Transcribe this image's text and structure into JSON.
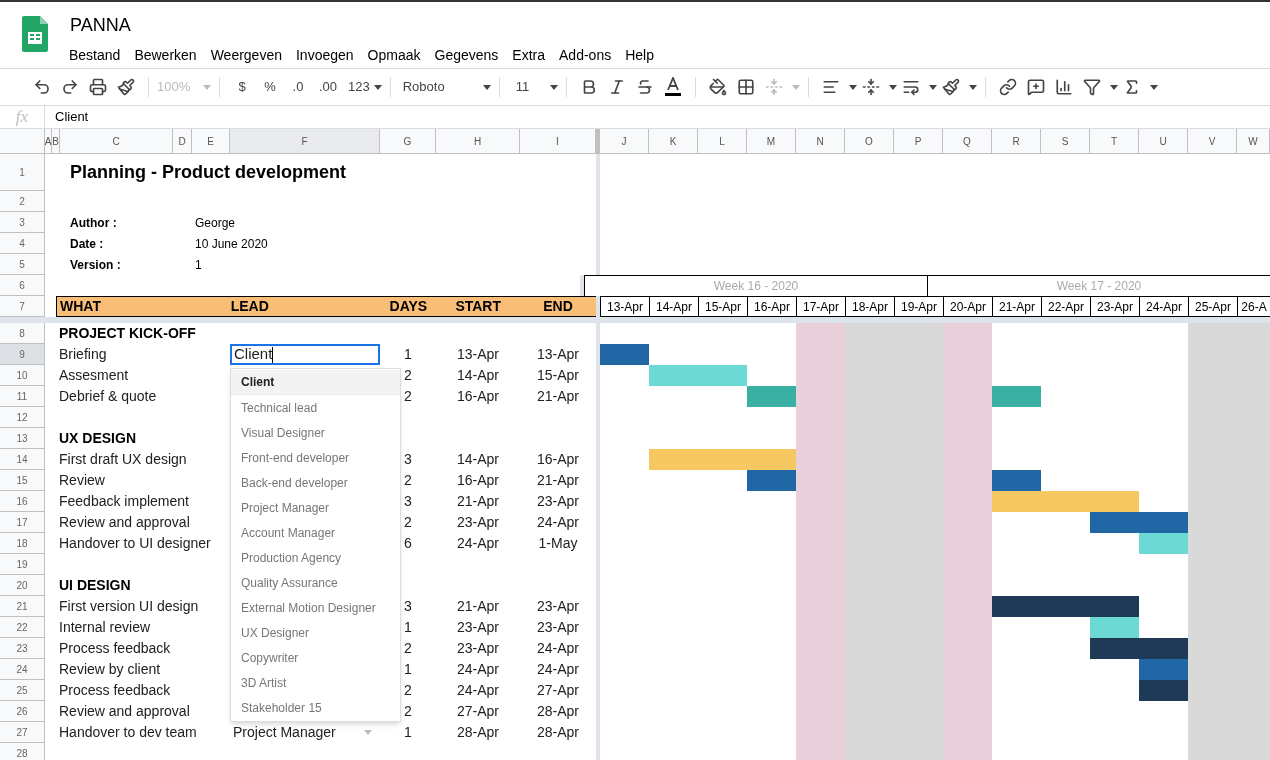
{
  "app": {
    "title": "PANNA",
    "menu": [
      "Bestand",
      "Bewerken",
      "Weergeven",
      "Invoegen",
      "Opmaak",
      "Gegevens",
      "Extra",
      "Add-ons",
      "Help"
    ]
  },
  "toolbar": {
    "zoom": "100%",
    "currency": "$",
    "percent": "%",
    "decrease_decimals": ".0",
    "increase_decimals": ".00",
    "number_format": "123",
    "font": "Roboto",
    "font_size": "11"
  },
  "formula_bar": {
    "label": "fx",
    "value": "Client"
  },
  "columns": [
    {
      "label": "A",
      "selected": false
    },
    {
      "label": "B",
      "selected": false
    },
    {
      "label": "C",
      "selected": false
    },
    {
      "label": "D",
      "selected": false
    },
    {
      "label": "E",
      "selected": false
    },
    {
      "label": "F",
      "selected": true
    },
    {
      "label": "G",
      "selected": false
    },
    {
      "label": "H",
      "selected": false
    },
    {
      "label": "I",
      "selected": false
    },
    {
      "label": "J",
      "selected": false
    },
    {
      "label": "K",
      "selected": false
    },
    {
      "label": "L",
      "selected": false
    },
    {
      "label": "M",
      "selected": false
    },
    {
      "label": "N",
      "selected": false
    },
    {
      "label": "O",
      "selected": false
    },
    {
      "label": "P",
      "selected": false
    },
    {
      "label": "Q",
      "selected": false
    },
    {
      "label": "R",
      "selected": false
    },
    {
      "label": "S",
      "selected": false
    },
    {
      "label": "T",
      "selected": false
    },
    {
      "label": "U",
      "selected": false
    },
    {
      "label": "V",
      "selected": false
    },
    {
      "label": "W",
      "selected": false
    }
  ],
  "row_numbers": [
    {
      "label": "1",
      "selected": false
    },
    {
      "label": "2",
      "selected": false
    },
    {
      "label": "3",
      "selected": false
    },
    {
      "label": "4",
      "selected": false
    },
    {
      "label": "5",
      "selected": false
    },
    {
      "label": "6",
      "selected": false
    },
    {
      "label": "7",
      "selected": false
    },
    {
      "label": "8",
      "selected": false
    },
    {
      "label": "9",
      "selected": true
    },
    {
      "label": "10",
      "selected": false
    },
    {
      "label": "11",
      "selected": false
    },
    {
      "label": "12",
      "selected": false
    },
    {
      "label": "13",
      "selected": false
    },
    {
      "label": "14",
      "selected": false
    },
    {
      "label": "15",
      "selected": false
    },
    {
      "label": "16",
      "selected": false
    },
    {
      "label": "17",
      "selected": false
    },
    {
      "label": "18",
      "selected": false
    },
    {
      "label": "19",
      "selected": false
    },
    {
      "label": "20",
      "selected": false
    },
    {
      "label": "21",
      "selected": false
    },
    {
      "label": "22",
      "selected": false
    },
    {
      "label": "23",
      "selected": false
    },
    {
      "label": "24",
      "selected": false
    },
    {
      "label": "25",
      "selected": false
    },
    {
      "label": "26",
      "selected": false
    },
    {
      "label": "27",
      "selected": false
    },
    {
      "label": "28",
      "selected": false
    }
  ],
  "sheet": {
    "title": "Planning - Product development",
    "meta": [
      {
        "label": "Author :",
        "value": "George"
      },
      {
        "label": "Date :",
        "value": "10 June 2020"
      },
      {
        "label": "Version :",
        "value": "1"
      }
    ],
    "headers": [
      "WHAT",
      "LEAD",
      "DAYS",
      "START",
      "END"
    ],
    "weeks": [
      "Week 16 - 2020",
      "Week 17 - 2020"
    ],
    "days": [
      {
        "label": "13-Apr",
        "kind": "workday"
      },
      {
        "label": "14-Apr",
        "kind": "workday"
      },
      {
        "label": "15-Apr",
        "kind": "workday"
      },
      {
        "label": "16-Apr",
        "kind": "workday"
      },
      {
        "label": "17-Apr",
        "kind": "holiday"
      },
      {
        "label": "18-Apr",
        "kind": "weekend"
      },
      {
        "label": "19-Apr",
        "kind": "weekend"
      },
      {
        "label": "20-Apr",
        "kind": "holiday"
      },
      {
        "label": "21-Apr",
        "kind": "workday"
      },
      {
        "label": "22-Apr",
        "kind": "workday"
      },
      {
        "label": "23-Apr",
        "kind": "workday"
      },
      {
        "label": "24-Apr",
        "kind": "workday"
      },
      {
        "label": "25-Apr",
        "kind": "weekend"
      },
      {
        "label": "26-A",
        "kind": "weekend"
      }
    ],
    "rows": [
      {
        "kind": "section",
        "what": "PROJECT KICK-OFF"
      },
      {
        "kind": "task",
        "what": "Briefing",
        "lead": "Client",
        "editing": true,
        "days": "1",
        "start": "13-Apr",
        "end": "13-Apr",
        "timeline": [
          {
            "kind": "bar",
            "color": "#2166a5"
          },
          {
            "kind": "empty"
          },
          {
            "kind": "empty"
          },
          {
            "kind": "empty"
          },
          {
            "kind": "empty"
          },
          {
            "kind": "empty"
          },
          {
            "kind": "empty"
          },
          {
            "kind": "empty"
          },
          {
            "kind": "empty"
          },
          {
            "kind": "empty"
          },
          {
            "kind": "empty"
          },
          {
            "kind": "empty"
          },
          {
            "kind": "empty"
          },
          {
            "kind": "empty"
          }
        ]
      },
      {
        "kind": "task",
        "what": "Assesment",
        "days": "2",
        "start": "14-Apr",
        "end": "15-Apr",
        "timeline": [
          {
            "kind": "empty"
          },
          {
            "kind": "bar",
            "color": "#6dd9d4"
          },
          {
            "kind": "bar",
            "color": "#6dd9d4"
          },
          {
            "kind": "empty"
          },
          {
            "kind": "empty"
          },
          {
            "kind": "empty"
          },
          {
            "kind": "empty"
          },
          {
            "kind": "empty"
          },
          {
            "kind": "empty"
          },
          {
            "kind": "empty"
          },
          {
            "kind": "empty"
          },
          {
            "kind": "empty"
          },
          {
            "kind": "empty"
          },
          {
            "kind": "empty"
          }
        ]
      },
      {
        "kind": "task",
        "what": "Debrief & quote",
        "days": "2",
        "start": "16-Apr",
        "end": "21-Apr",
        "timeline": [
          {
            "kind": "empty"
          },
          {
            "kind": "empty"
          },
          {
            "kind": "empty"
          },
          {
            "kind": "bar",
            "color": "#3aafa4"
          },
          {
            "kind": "empty"
          },
          {
            "kind": "empty"
          },
          {
            "kind": "empty"
          },
          {
            "kind": "empty"
          },
          {
            "kind": "bar",
            "color": "#3aafa4"
          },
          {
            "kind": "empty"
          },
          {
            "kind": "empty"
          },
          {
            "kind": "empty"
          },
          {
            "kind": "empty"
          },
          {
            "kind": "empty"
          }
        ]
      },
      {
        "kind": "blank"
      },
      {
        "kind": "section",
        "what": "UX DESIGN"
      },
      {
        "kind": "task",
        "what": "First draft UX design",
        "days": "3",
        "start": "14-Apr",
        "end": "16-Apr",
        "timeline": [
          {
            "kind": "empty"
          },
          {
            "kind": "bar",
            "color": "#f5c862"
          },
          {
            "kind": "bar",
            "color": "#f5c862"
          },
          {
            "kind": "bar",
            "color": "#f5c862"
          },
          {
            "kind": "empty"
          },
          {
            "kind": "empty"
          },
          {
            "kind": "empty"
          },
          {
            "kind": "empty"
          },
          {
            "kind": "empty"
          },
          {
            "kind": "empty"
          },
          {
            "kind": "empty"
          },
          {
            "kind": "empty"
          },
          {
            "kind": "empty"
          },
          {
            "kind": "empty"
          }
        ]
      },
      {
        "kind": "task",
        "what": "Review",
        "days": "2",
        "start": "16-Apr",
        "end": "21-Apr",
        "timeline": [
          {
            "kind": "empty"
          },
          {
            "kind": "empty"
          },
          {
            "kind": "empty"
          },
          {
            "kind": "bar",
            "color": "#2166a5"
          },
          {
            "kind": "empty"
          },
          {
            "kind": "empty"
          },
          {
            "kind": "empty"
          },
          {
            "kind": "empty"
          },
          {
            "kind": "bar",
            "color": "#2166a5"
          },
          {
            "kind": "empty"
          },
          {
            "kind": "empty"
          },
          {
            "kind": "empty"
          },
          {
            "kind": "empty"
          },
          {
            "kind": "empty"
          }
        ]
      },
      {
        "kind": "task",
        "what": "Feedback implement",
        "days": "3",
        "start": "21-Apr",
        "end": "23-Apr",
        "timeline": [
          {
            "kind": "empty"
          },
          {
            "kind": "empty"
          },
          {
            "kind": "empty"
          },
          {
            "kind": "empty"
          },
          {
            "kind": "empty"
          },
          {
            "kind": "empty"
          },
          {
            "kind": "empty"
          },
          {
            "kind": "empty"
          },
          {
            "kind": "bar",
            "color": "#f5c862"
          },
          {
            "kind": "bar",
            "color": "#f5c862"
          },
          {
            "kind": "bar",
            "color": "#f5c862"
          },
          {
            "kind": "empty"
          },
          {
            "kind": "empty"
          },
          {
            "kind": "empty"
          }
        ]
      },
      {
        "kind": "task",
        "what": "Review and approval",
        "days": "2",
        "start": "23-Apr",
        "end": "24-Apr",
        "timeline": [
          {
            "kind": "empty"
          },
          {
            "kind": "empty"
          },
          {
            "kind": "empty"
          },
          {
            "kind": "empty"
          },
          {
            "kind": "empty"
          },
          {
            "kind": "empty"
          },
          {
            "kind": "empty"
          },
          {
            "kind": "empty"
          },
          {
            "kind": "empty"
          },
          {
            "kind": "empty"
          },
          {
            "kind": "bar",
            "color": "#2166a5"
          },
          {
            "kind": "bar",
            "color": "#2166a5"
          },
          {
            "kind": "empty"
          },
          {
            "kind": "empty"
          }
        ]
      },
      {
        "kind": "task",
        "what": "Handover to UI designer",
        "days": "6",
        "start": "24-Apr",
        "end": "1-May",
        "timeline": [
          {
            "kind": "empty"
          },
          {
            "kind": "empty"
          },
          {
            "kind": "empty"
          },
          {
            "kind": "empty"
          },
          {
            "kind": "empty"
          },
          {
            "kind": "empty"
          },
          {
            "kind": "empty"
          },
          {
            "kind": "empty"
          },
          {
            "kind": "empty"
          },
          {
            "kind": "empty"
          },
          {
            "kind": "empty"
          },
          {
            "kind": "bar",
            "color": "#6dd9d4"
          },
          {
            "kind": "empty"
          },
          {
            "kind": "empty"
          }
        ]
      },
      {
        "kind": "blank"
      },
      {
        "kind": "section",
        "what": "UI DESIGN"
      },
      {
        "kind": "task",
        "what": "First version UI design",
        "days": "3",
        "start": "21-Apr",
        "end": "23-Apr",
        "timeline": [
          {
            "kind": "empty"
          },
          {
            "kind": "empty"
          },
          {
            "kind": "empty"
          },
          {
            "kind": "empty"
          },
          {
            "kind": "empty"
          },
          {
            "kind": "empty"
          },
          {
            "kind": "empty"
          },
          {
            "kind": "empty"
          },
          {
            "kind": "bar",
            "color": "#1e3a56"
          },
          {
            "kind": "bar",
            "color": "#1e3a56"
          },
          {
            "kind": "bar",
            "color": "#1e3a56"
          },
          {
            "kind": "empty"
          },
          {
            "kind": "empty"
          },
          {
            "kind": "empty"
          }
        ]
      },
      {
        "kind": "task",
        "what": "Internal review",
        "days": "1",
        "start": "23-Apr",
        "end": "23-Apr",
        "timeline": [
          {
            "kind": "empty"
          },
          {
            "kind": "empty"
          },
          {
            "kind": "empty"
          },
          {
            "kind": "empty"
          },
          {
            "kind": "empty"
          },
          {
            "kind": "empty"
          },
          {
            "kind": "empty"
          },
          {
            "kind": "empty"
          },
          {
            "kind": "empty"
          },
          {
            "kind": "empty"
          },
          {
            "kind": "bar",
            "color": "#6dd9d4"
          },
          {
            "kind": "empty"
          },
          {
            "kind": "empty"
          },
          {
            "kind": "empty"
          }
        ]
      },
      {
        "kind": "task",
        "what": "Process feedback",
        "days": "2",
        "start": "23-Apr",
        "end": "24-Apr",
        "timeline": [
          {
            "kind": "empty"
          },
          {
            "kind": "empty"
          },
          {
            "kind": "empty"
          },
          {
            "kind": "empty"
          },
          {
            "kind": "empty"
          },
          {
            "kind": "empty"
          },
          {
            "kind": "empty"
          },
          {
            "kind": "empty"
          },
          {
            "kind": "empty"
          },
          {
            "kind": "empty"
          },
          {
            "kind": "bar",
            "color": "#1e3a56"
          },
          {
            "kind": "bar",
            "color": "#1e3a56"
          },
          {
            "kind": "empty"
          },
          {
            "kind": "empty"
          }
        ]
      },
      {
        "kind": "task",
        "what": "Review by client",
        "days": "1",
        "start": "24-Apr",
        "end": "24-Apr",
        "timeline": [
          {
            "kind": "empty"
          },
          {
            "kind": "empty"
          },
          {
            "kind": "empty"
          },
          {
            "kind": "empty"
          },
          {
            "kind": "empty"
          },
          {
            "kind": "empty"
          },
          {
            "kind": "empty"
          },
          {
            "kind": "empty"
          },
          {
            "kind": "empty"
          },
          {
            "kind": "empty"
          },
          {
            "kind": "empty"
          },
          {
            "kind": "bar",
            "color": "#2166a5"
          },
          {
            "kind": "empty"
          },
          {
            "kind": "empty"
          }
        ]
      },
      {
        "kind": "task",
        "what": "Process feedback",
        "days": "2",
        "start": "24-Apr",
        "end": "27-Apr",
        "timeline": [
          {
            "kind": "empty"
          },
          {
            "kind": "empty"
          },
          {
            "kind": "empty"
          },
          {
            "kind": "empty"
          },
          {
            "kind": "empty"
          },
          {
            "kind": "empty"
          },
          {
            "kind": "empty"
          },
          {
            "kind": "empty"
          },
          {
            "kind": "empty"
          },
          {
            "kind": "empty"
          },
          {
            "kind": "empty"
          },
          {
            "kind": "bar",
            "color": "#1e3a56"
          },
          {
            "kind": "empty"
          },
          {
            "kind": "empty"
          }
        ]
      },
      {
        "kind": "task",
        "what": "Review and approval",
        "days": "2",
        "start": "27-Apr",
        "end": "28-Apr"
      },
      {
        "kind": "task",
        "what": "Handover to dev team",
        "lead": "Project Manager",
        "editing": false,
        "days": "1",
        "start": "28-Apr",
        "end": "28-Apr"
      },
      {
        "kind": "blank"
      }
    ]
  },
  "dropdown": {
    "options": [
      {
        "label": "Client",
        "selected": true
      },
      {
        "label": "Technical lead",
        "selected": false
      },
      {
        "label": "Visual Designer",
        "selected": false
      },
      {
        "label": "Front-end developer",
        "selected": false
      },
      {
        "label": "Back-end developer",
        "selected": false
      },
      {
        "label": "Project Manager",
        "selected": false
      },
      {
        "label": "Account Manager",
        "selected": false
      },
      {
        "label": "Production Agency",
        "selected": false
      },
      {
        "label": "Quality Assurance",
        "selected": false
      },
      {
        "label": "External Motion Designer",
        "selected": false
      },
      {
        "label": "UX Designer",
        "selected": false
      },
      {
        "label": "Copywriter",
        "selected": false
      },
      {
        "label": "3D Artist",
        "selected": false
      },
      {
        "label": "Stakeholder 15",
        "selected": false
      }
    ]
  }
}
